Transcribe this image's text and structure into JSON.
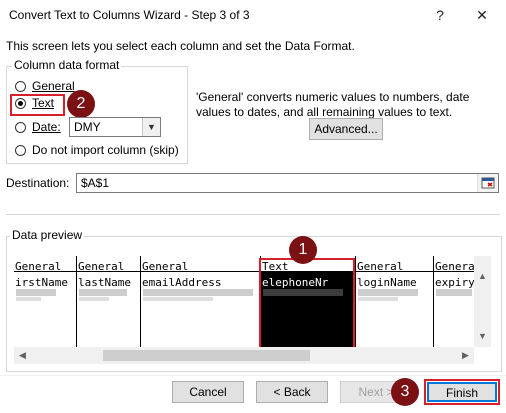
{
  "window": {
    "title": "Convert Text to Columns Wizard - Step 3 of 3",
    "help_label": "?",
    "close_label": "✕"
  },
  "description": "This screen lets you select each column and set the Data Format.",
  "column_format": {
    "legend": "Column data format",
    "options": [
      {
        "label": "General",
        "selected": false
      },
      {
        "label": "Text",
        "selected": true
      },
      {
        "label": "Date:",
        "selected": false
      },
      {
        "label": "Do not import column (skip)",
        "selected": false
      }
    ],
    "date_format": "DMY"
  },
  "info_text": "'General' converts numeric values to numbers, date values to dates, and all remaining values to text.",
  "advanced_label": "Advanced...",
  "destination": {
    "label": "Destination:",
    "value": "$A$1"
  },
  "preview": {
    "legend": "Data preview",
    "columns": [
      {
        "header": "General",
        "name": "irstName"
      },
      {
        "header": "General",
        "name": "lastName"
      },
      {
        "header": "General",
        "name": "emailAddress"
      },
      {
        "header": "Text",
        "name": "elephoneNr",
        "selected": true
      },
      {
        "header": "General",
        "name": "loginName"
      },
      {
        "header": "Genera",
        "name": "expiry"
      }
    ]
  },
  "buttons": {
    "cancel": "Cancel",
    "back": "< Back",
    "next": "Next >",
    "finish": "Finish"
  },
  "callouts": [
    "1",
    "2",
    "3"
  ],
  "colors": {
    "highlight": "#d8202a",
    "badge": "#7b1113",
    "default_button_border": "#0078d7"
  }
}
